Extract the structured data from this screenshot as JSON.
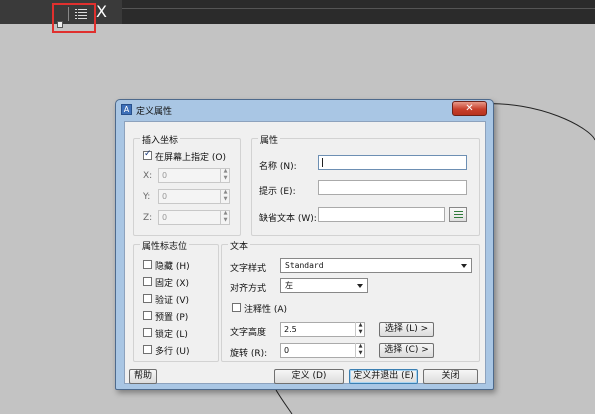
{
  "toolbar": {
    "close_glyph": "X",
    "list_icon": "list-icon"
  },
  "dialog": {
    "title": "定义属性",
    "close_glyph": "✕",
    "insert_group": {
      "legend": "插入坐标",
      "on_screen_label": "在屏幕上指定 (O)",
      "on_screen_checked": true,
      "x_label": "X:",
      "x_value": "0",
      "y_label": "Y:",
      "y_value": "0",
      "z_label": "Z:",
      "z_value": "0"
    },
    "attribute_group": {
      "legend": "属性",
      "name_label": "名称 (N):",
      "name_value": "",
      "prompt_label": "提示 (E):",
      "prompt_value": "",
      "default_label": "缺省文本 (W):",
      "default_value": ""
    },
    "mode_group": {
      "legend": "属性标志位",
      "options": [
        {
          "label": "隐藏 (H)",
          "checked": false
        },
        {
          "label": "固定 (X)",
          "checked": false
        },
        {
          "label": "验证 (V)",
          "checked": false
        },
        {
          "label": "预置 (P)",
          "checked": false
        },
        {
          "label": "锁定 (L)",
          "checked": false
        },
        {
          "label": "多行 (U)",
          "checked": false
        }
      ]
    },
    "text_group": {
      "legend": "文本",
      "style_label": "文字样式",
      "style_value": "Standard",
      "justify_label": "对齐方式",
      "justify_value": "左",
      "annotative_label": "注释性 (A)",
      "annotative_checked": false,
      "height_label": "文字高度",
      "height_value": "2.5",
      "height_pick_label": "选择 (L) >",
      "rotation_label": "旋转 (R):",
      "rotation_value": "0",
      "rotation_pick_label": "选择 (C) >"
    },
    "buttons": {
      "help": "帮助",
      "define": "定义 (D)",
      "define_exit": "定义并退出 (E)",
      "close": "关闭"
    }
  }
}
